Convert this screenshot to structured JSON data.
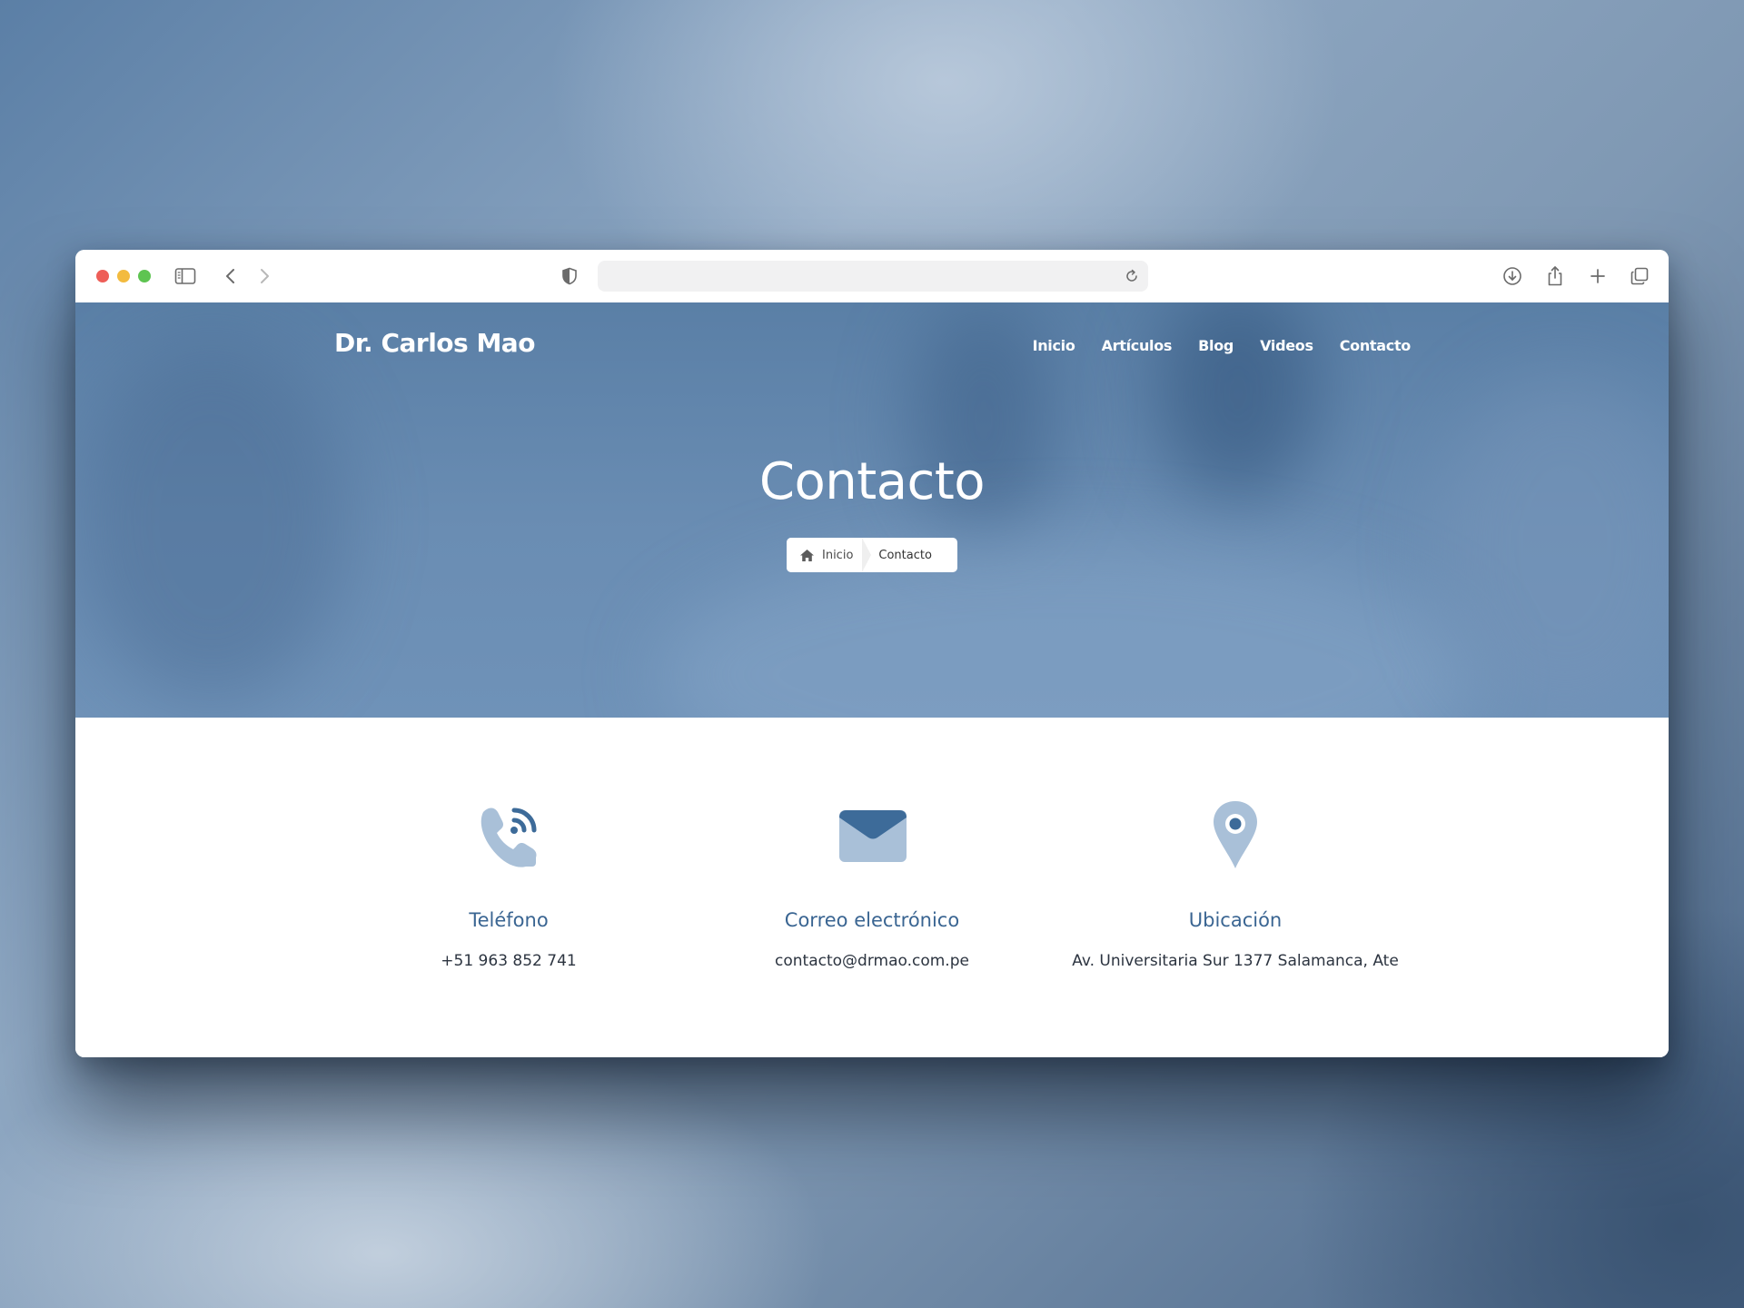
{
  "browser": {
    "icons": {
      "sidebar": "sidebar-icon",
      "back": "chevron-left-icon",
      "forward": "chevron-right-icon",
      "shield": "shield-icon",
      "reload": "reload-icon",
      "download": "download-icon",
      "share": "share-icon",
      "new_tab": "plus-icon",
      "tabs": "tabs-overview-icon"
    },
    "address": ""
  },
  "site": {
    "brand": "Dr. Carlos Mao",
    "nav": [
      {
        "label": "Inicio"
      },
      {
        "label": "Artículos"
      },
      {
        "label": "Blog"
      },
      {
        "label": "Videos"
      },
      {
        "label": "Contacto"
      }
    ]
  },
  "hero": {
    "title": "Contacto",
    "breadcrumb": {
      "home": "Inicio",
      "current": "Contacto"
    }
  },
  "contact": {
    "items": [
      {
        "icon": "phone-icon",
        "title": "Teléfono",
        "value": "+51 963 852 741"
      },
      {
        "icon": "envelope-icon",
        "title": "Correo electrónico",
        "value": "contacto@drmao.com.pe"
      },
      {
        "icon": "map-pin-icon",
        "title": "Ubicación",
        "value": "Av. Universitaria Sur 1377 Salamanca, Ate"
      }
    ]
  },
  "colors": {
    "accent": "#3a6592",
    "icon_light": "#a9c0d8",
    "icon_dark": "#3d6b99",
    "hero": "#6a8db3"
  }
}
